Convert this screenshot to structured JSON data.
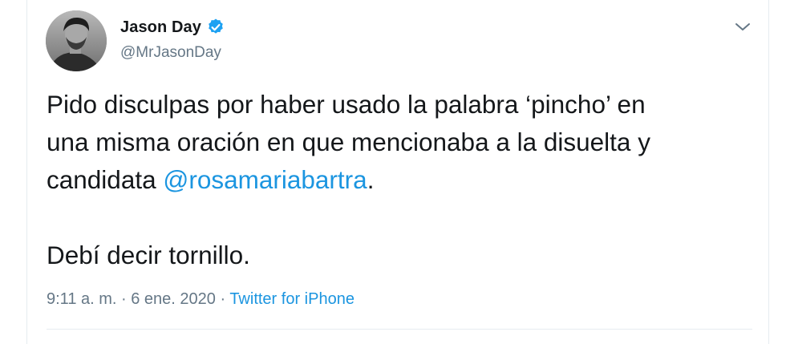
{
  "author": {
    "display_name": "Jason Day",
    "handle": "@MrJasonDay",
    "verified": true
  },
  "icons": {
    "avatar": "profile-photo",
    "verified": "verified-badge-icon",
    "menu": "chevron-down-icon"
  },
  "tweet": {
    "line1": "Pido disculpas por haber usado la palabra ‘pincho’ en",
    "line2": "una misma oración en que mencionaba a la disuelta y",
    "line3_prefix": "candidata ",
    "mention": "@rosamariabartra",
    "line3_suffix": ".",
    "line4": "Debí decir tornillo."
  },
  "meta": {
    "time": "9:11 a. m.",
    "separator1": " · ",
    "date": "6 ene. 2020",
    "separator2": " · ",
    "source": "Twitter for iPhone"
  },
  "colors": {
    "text": "#14171a",
    "secondary": "#657786",
    "link": "#1b95e0",
    "border": "#e6ecf0"
  }
}
